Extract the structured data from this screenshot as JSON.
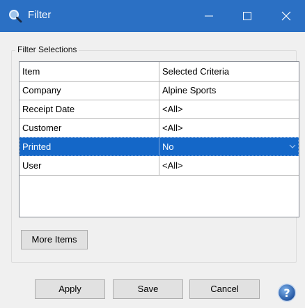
{
  "window": {
    "title": "Filter",
    "icon": "magnifier-icon",
    "controls": {
      "minimize": "minimize-icon",
      "maximize": "maximize-icon",
      "close": "close-icon"
    },
    "accent_color": "#2b70c4"
  },
  "filter_group": {
    "label": "Filter Selections",
    "columns": [
      "Item",
      "Selected Criteria"
    ],
    "rows": [
      {
        "item": "Company",
        "criteria": "Alpine Sports",
        "selected": false
      },
      {
        "item": "Receipt Date",
        "criteria": "<All>",
        "selected": false
      },
      {
        "item": "Customer",
        "criteria": "<All>",
        "selected": false
      },
      {
        "item": "Printed",
        "criteria": "No",
        "selected": true
      },
      {
        "item": "User",
        "criteria": "<All>",
        "selected": false
      }
    ],
    "selection_color": "#1467c8",
    "more_button": "More Items"
  },
  "buttons": {
    "apply": "Apply",
    "save": "Save",
    "cancel": "Cancel",
    "help_icon": "help-icon"
  }
}
